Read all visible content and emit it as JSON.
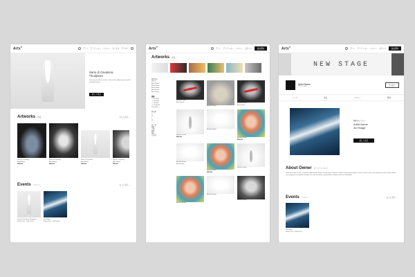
{
  "brand": {
    "logo_text": "Artx",
    "logo_sup": "®"
  },
  "nav": {
    "items": [
      "アート",
      "アーティスト",
      "イベント",
      "サービス",
      "アバウト"
    ],
    "login": "ログイン",
    "register": "会員登録"
  },
  "home": {
    "hero": {
      "title_line1": "Sans di Cavaleria",
      "title_line2": "²Sculpture",
      "desc": "Lorem ipsum dolor sit amet, consectetur adipiscing elit sed do eiusmod tempor",
      "button": "詳しく見る"
    },
    "artworks": {
      "title": "Artworks",
      "sub": "作品",
      "see_more": "もっと見る →",
      "items": [
        {
          "name": "Sans di Cavaleria",
          "artist": "Artist Name",
          "price": "¥88,000"
        },
        {
          "name": "Sans di Cavaleria",
          "artist": "Artist Name",
          "price": "¥88,000"
        },
        {
          "name": "Sans di Cavaleria",
          "artist": "Artist Name",
          "price": "¥88,000"
        },
        {
          "name": "Sans di Cavaleria",
          "artist": "Artist Name",
          "price": "¥88,000"
        }
      ]
    },
    "events": {
      "title": "Events",
      "sub": "イベント",
      "see_more": "もっと見る →",
      "items": [
        {
          "name": "Sans di Cavaleria ²Sculpture",
          "date": "2020.01.01 - 2020.02.01"
        },
        {
          "name": "3rd Stage",
          "date": "2020.01.01 - 2020.02.01"
        }
      ]
    }
  },
  "list": {
    "title": "Artworks",
    "sub": "作品",
    "filters": {
      "group1": "カテゴリ",
      "group1_items": [
        "すべて",
        "Artist Name",
        "Artist Name",
        "Artist Name",
        "Artist Name",
        "Artist Name"
      ],
      "group2": "価格",
      "group2_items": [
        "〜 ¥10,000",
        "〜 ¥30,000",
        "〜 ¥50,000",
        "〜 ¥100,000",
        "¥100,000 〜"
      ],
      "group3": "サイズ",
      "group3_items": [
        "S",
        "M",
        "L",
        "XL"
      ],
      "group4": "テーマ",
      "group4_items": [
        "抽象",
        "人物",
        "動物",
        "風景",
        "その他"
      ]
    },
    "card_name": "Artwork Name",
    "card_artist": "Artist Name",
    "card_price": "¥88,000"
  },
  "artist": {
    "banner": "NEW STAGE",
    "name": "Artist Name",
    "name_sub": "アーティスト",
    "follow": "フォロー",
    "tabs": [
      "トップ",
      "作品",
      "イベント",
      "概要"
    ],
    "feature": {
      "label": "開催中のイベント",
      "title": "Artist Name",
      "title2": "3rd Stage",
      "button": "詳しく見る"
    },
    "about": {
      "title": "About Owner",
      "sub": "オーナーについて",
      "text": "Lorem ipsum dolor sit amet, consectetur adipiscing elit, sed do eiusmod tempor incididunt ut labore et dolore magna aliqua. Ut enim ad minim veniam, quis nostrud exercitation ullamco laboris nisi ut aliquip ex ea commodo consequat. Duis aute irure dolor in reprehenderit in voluptate velit esse cillum dolore."
    },
    "events": {
      "title": "Events",
      "sub": "イベント",
      "see_more": "もっと見る →",
      "item_name": "3rd Stage",
      "item_date": "2020.01.01 - 2020.02.01"
    }
  }
}
